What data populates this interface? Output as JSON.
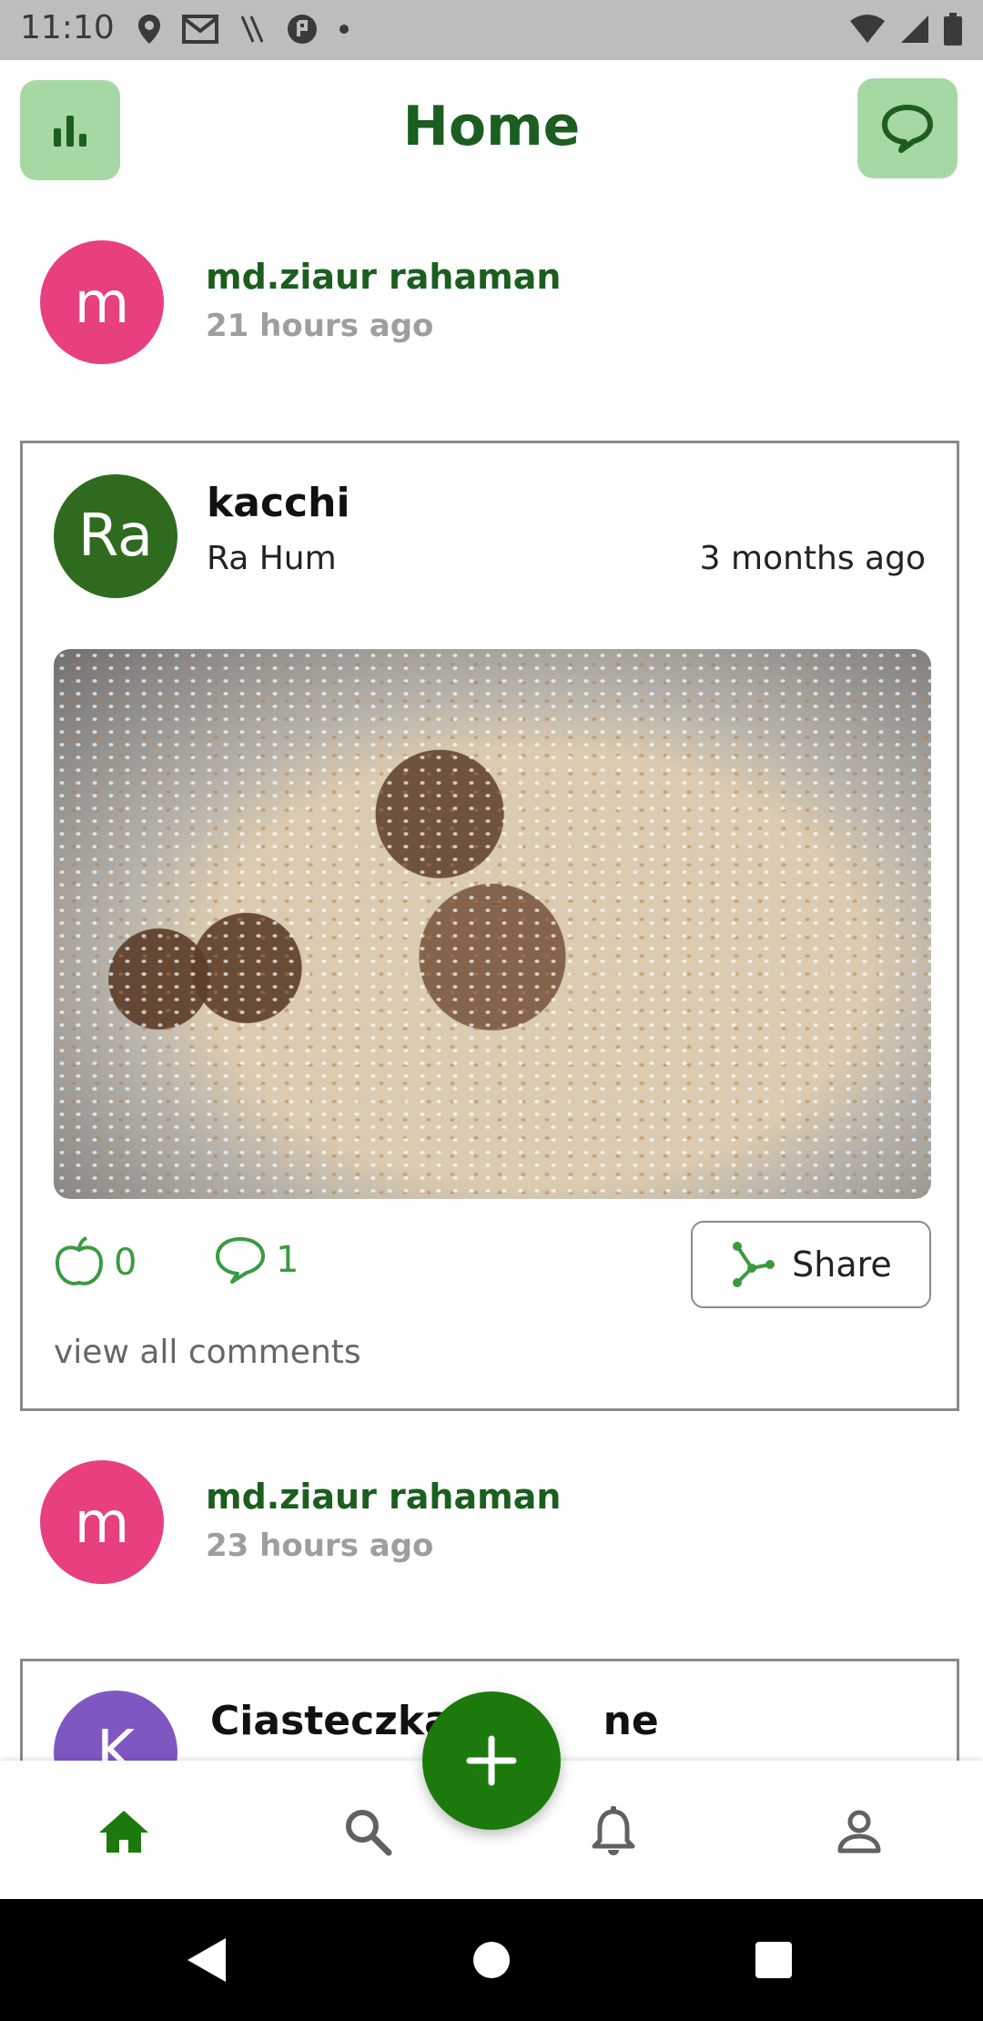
{
  "status_bar": {
    "time": "11:10"
  },
  "header": {
    "title": "Home"
  },
  "activities": [
    {
      "avatar_letter": "m",
      "name": "md.ziaur rahaman",
      "time": "21 hours ago"
    },
    {
      "avatar_letter": "m",
      "name": "md.ziaur rahaman",
      "time": "23 hours ago"
    }
  ],
  "post": {
    "avatar_initials": "Ra",
    "title": "kacchi",
    "author": "Ra Hum",
    "time": "3 months ago",
    "likes": "0",
    "comments": "1",
    "share_label": "Share",
    "view_comments": "view all comments"
  },
  "post2": {
    "avatar_letter": "K",
    "title": "Ciasteczka p",
    "title_tail": "ne"
  },
  "colors": {
    "primary": "#1b5e20",
    "accent": "#3a9a41",
    "fab": "#1b7a0b",
    "button_bg": "#a6d8a4",
    "avatar_pink": "#e83f7f",
    "avatar_green": "#2e6b1e",
    "avatar_purple": "#7e57c2"
  },
  "icons": {
    "stats": "bar-chart-icon",
    "chat": "chat-bubble-icon",
    "like": "apple-icon",
    "comment": "comment-icon",
    "share": "share-icon",
    "home": "home-icon",
    "search": "search-icon",
    "notifications": "bell-icon",
    "profile": "person-icon",
    "add": "plus-icon"
  }
}
